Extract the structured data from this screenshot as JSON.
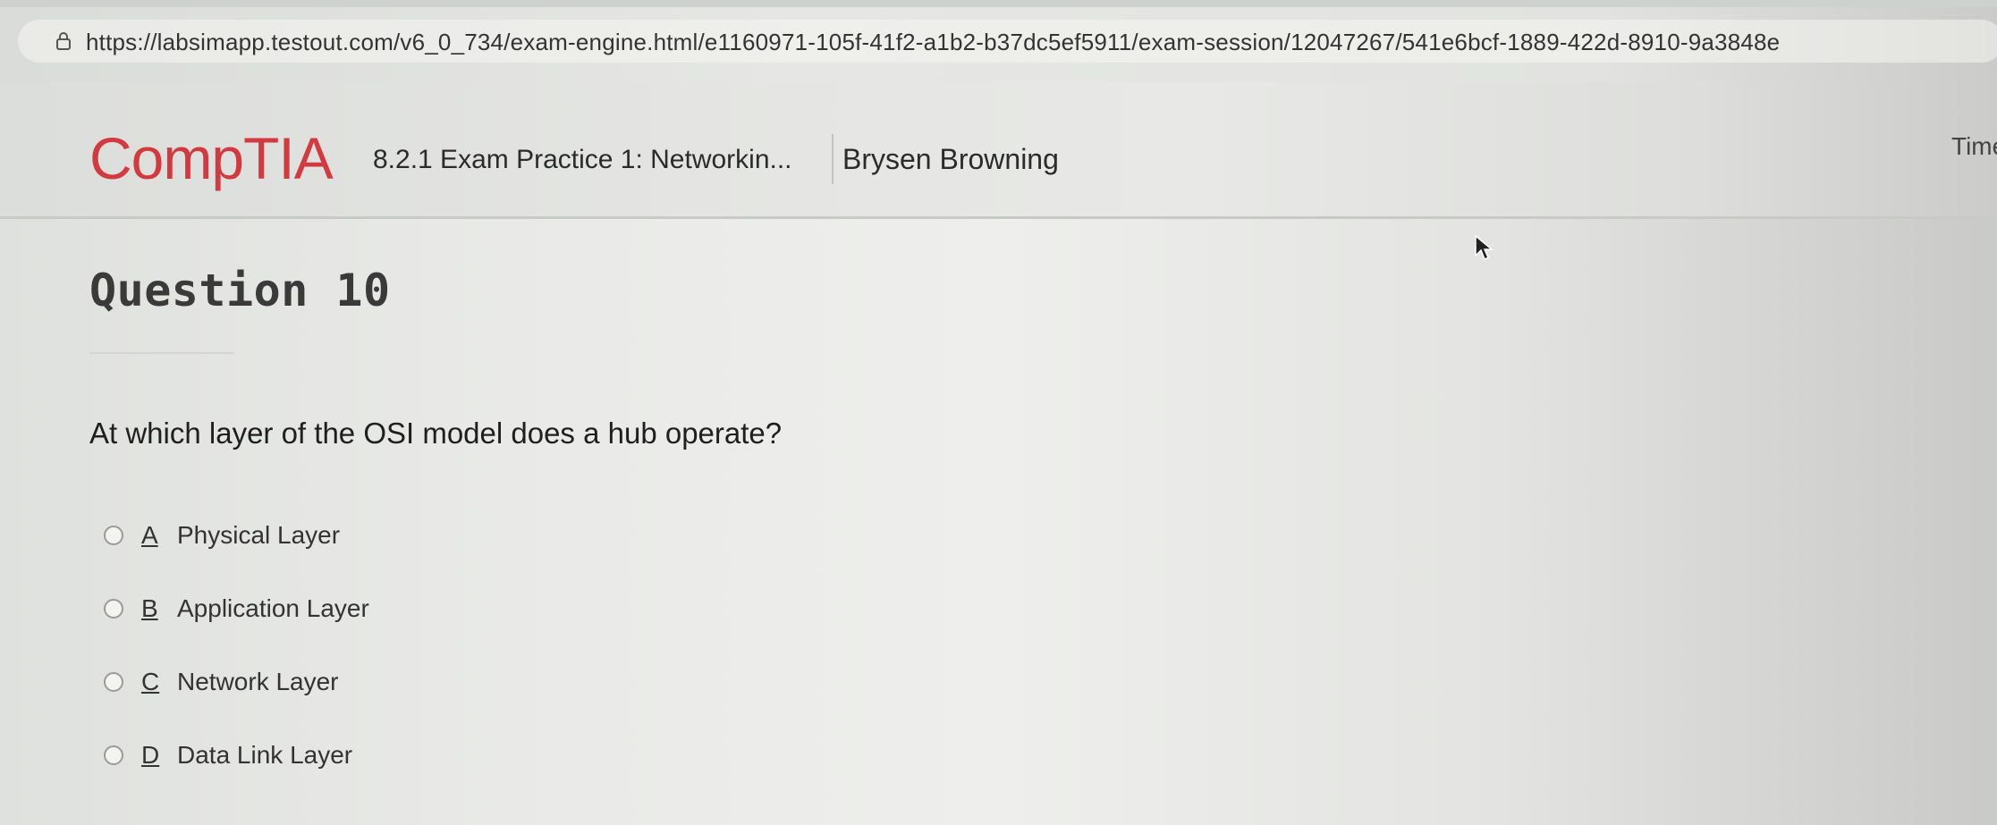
{
  "browser": {
    "url": "https://labsimapp.testout.com/v6_0_734/exam-engine.html/e1160971-105f-41f2-a1b2-b37dc5ef5911/exam-session/12047267/541e6bcf-1889-422d-8910-9a3848e"
  },
  "header": {
    "brand": "CompTIA",
    "exam_title": "8.2.1 Exam Practice 1: Networkin...",
    "user_name": "Brysen Browning",
    "time_label": "Time"
  },
  "question": {
    "heading": "Question 10",
    "text": "At which layer of the OSI model does a hub operate?",
    "options": [
      {
        "letter": "A",
        "label": "Physical Layer"
      },
      {
        "letter": "B",
        "label": "Application Layer"
      },
      {
        "letter": "C",
        "label": "Network Layer"
      },
      {
        "letter": "D",
        "label": "Data Link Layer"
      }
    ]
  },
  "colors": {
    "brand": "#d23a3f"
  }
}
